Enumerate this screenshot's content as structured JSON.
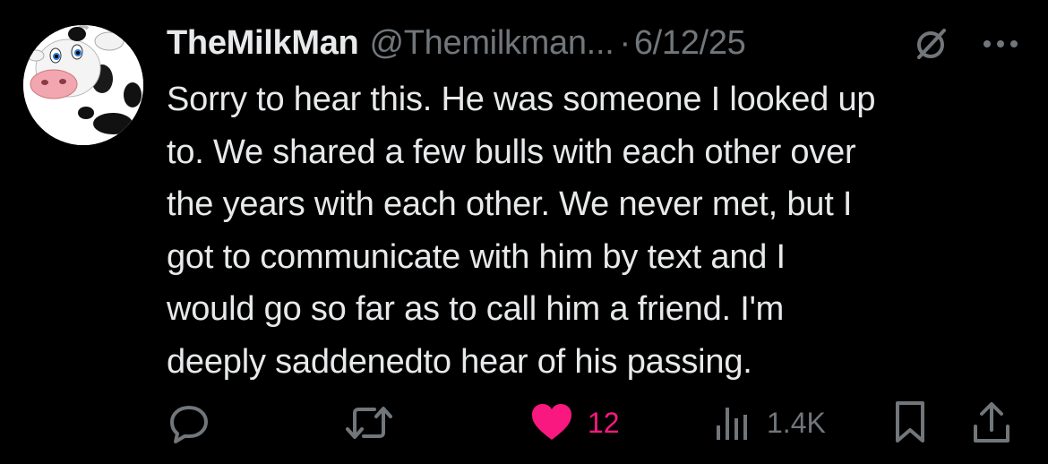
{
  "tweet": {
    "display_name": "TheMilkMan",
    "handle": "@Themilkman...",
    "separator": "·",
    "date": "6/12/25",
    "body_lines": [
      "Sorry to hear this. He was someone I looked up",
      "to. We shared a few bulls with each other over",
      "the years with each other. We never met, but I",
      "got to communicate with him by text and I",
      "would go so far as to call him a friend. I'm",
      "deeply saddenedto hear of his passing."
    ],
    "avatar_icon": "cow-avatar-icon",
    "grok_icon": "slashed-circle-icon",
    "more_icon": "more-dots-icon"
  },
  "actions": {
    "reply": {
      "icon": "reply-icon",
      "count": ""
    },
    "repost": {
      "icon": "repost-icon",
      "count": ""
    },
    "like": {
      "icon": "heart-icon",
      "count": "12",
      "liked": true
    },
    "views": {
      "icon": "views-icon",
      "count": "1.4K"
    },
    "bookmark": {
      "icon": "bookmark-icon"
    },
    "share": {
      "icon": "share-icon"
    }
  },
  "colors": {
    "background": "#000000",
    "text": "#e7e9ea",
    "muted": "#71767b",
    "like": "#f91880"
  }
}
